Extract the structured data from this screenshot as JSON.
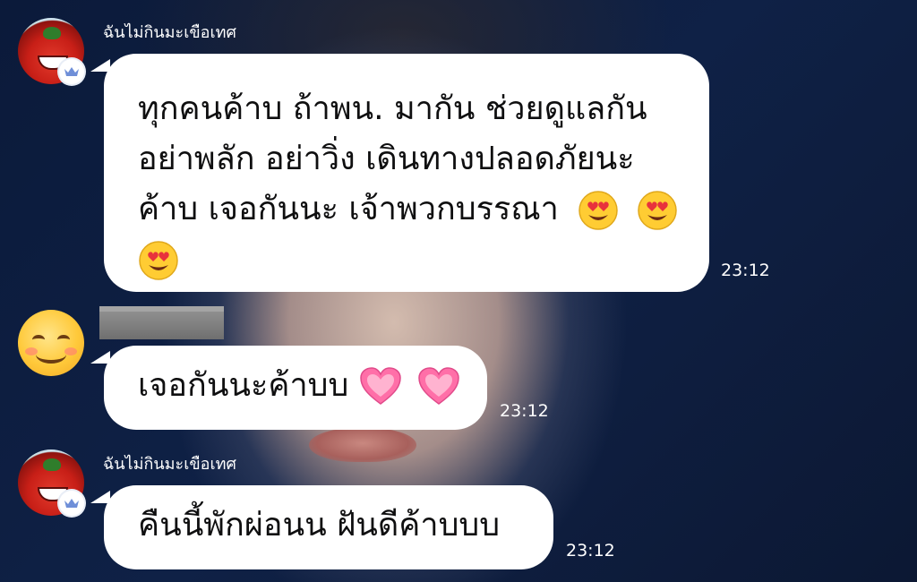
{
  "messages": [
    {
      "sender": "ฉันไม่กินมะเขือเทศ",
      "lines": [
        "ทุกคนค้าบ ถ้าพน. มากัน ช่วยดูแลกัน",
        "อย่าพลัก อย่าวิ่ง เดินทางปลอดภัยนะ",
        "ค้าบ เจอกันนะ เจ้าพวกบรรณา"
      ],
      "emoji": "heart-eyes-emoji",
      "time": "23:12"
    },
    {
      "sender": "",
      "lines": [
        "เจอกันนะค้าบบ"
      ],
      "emoji": "sparkling-heart-emoji",
      "time": "23:12"
    },
    {
      "sender": "ฉันไม่กินมะเขือเทศ",
      "lines": [
        "คืนนี้พักผ่อนน ฝันดีค้าบบบ"
      ],
      "time": "23:12"
    }
  ],
  "colors": {
    "bubble": "#ffffff",
    "background": "#0e1a33",
    "badge_crown": "#6f8fd8"
  },
  "icons": {
    "admin_badge": "crown-icon",
    "avatar_1": "tomato-avatar",
    "avatar_2": "smiling-face-avatar"
  }
}
